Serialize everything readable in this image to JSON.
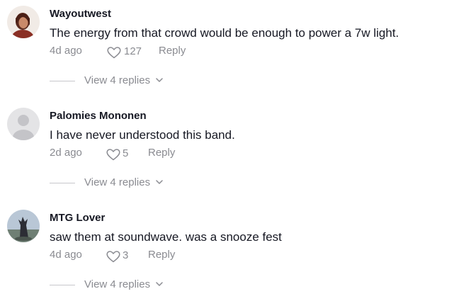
{
  "colors": {
    "text_primary": "#161823",
    "text_secondary": "#8a8b91",
    "divider": "#c7c7cb",
    "background": "#ffffff"
  },
  "comments": [
    {
      "avatar_icon": "profile-photo-icon",
      "username": "Wayoutwest",
      "text": "The energy from that crowd would be enough to power a 7w light.",
      "date": "4d ago",
      "likes": "127",
      "reply_label": "Reply",
      "view_replies_label": "View 4 replies"
    },
    {
      "avatar_icon": "default-avatar-icon",
      "username": "Palomies Mononen",
      "text": "I have never understood this band.",
      "date": "2d ago",
      "likes": "5",
      "reply_label": "Reply",
      "view_replies_label": "View 4 replies"
    },
    {
      "avatar_icon": "profile-photo-icon",
      "username": "MTG Lover",
      "text": "saw them at soundwave. was a snooze fest",
      "date": "4d ago",
      "likes": "3",
      "reply_label": "Reply",
      "view_replies_label": "View 4 replies"
    }
  ]
}
